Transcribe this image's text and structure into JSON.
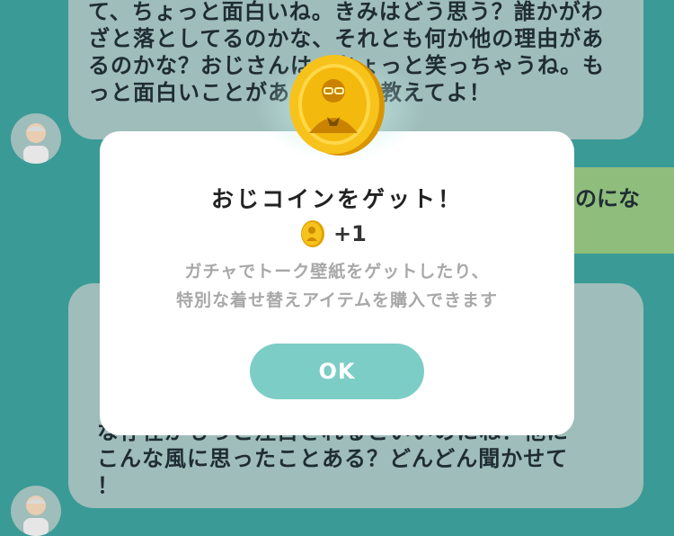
{
  "chat": {
    "top_message": "て、ちょっと面白いね。きみはどう思う？誰かがわざと落としてるのかな、それとも何か他の理由があるのかな？おじさんは、ちょっと笑っちゃうね。もっと面白いことがあったら、教えてよ！",
    "right_message_visible": "のにな",
    "bottom_message_visible": "…面白き引大事集また事たいな存在がもっと注目されるといいのにね？他にこんな風に思ったことある？どんどん聞かせて！",
    "bottom_line_1": "な存在がもっと注目されるといいのにね？他に",
    "bottom_line_2": "こんな風に思ったことある？どんどん聞かせて",
    "bottom_line_3": "！"
  },
  "modal": {
    "title": "おじコインをゲット！",
    "reward": "+1",
    "description_line1": "ガチャでトーク壁紙をゲットしたり、",
    "description_line2": "特別な着せ替えアイテムを購入できます",
    "ok_label": "OK"
  },
  "colors": {
    "background": "#3a9a96",
    "bubble_gray": "#9fbdbb",
    "bubble_green": "#8fbd7c",
    "ok_button": "#7ccdc6",
    "coin_gold": "#f2b705"
  },
  "icons": {
    "coin": "coin-icon",
    "avatar": "old-man-avatar"
  }
}
